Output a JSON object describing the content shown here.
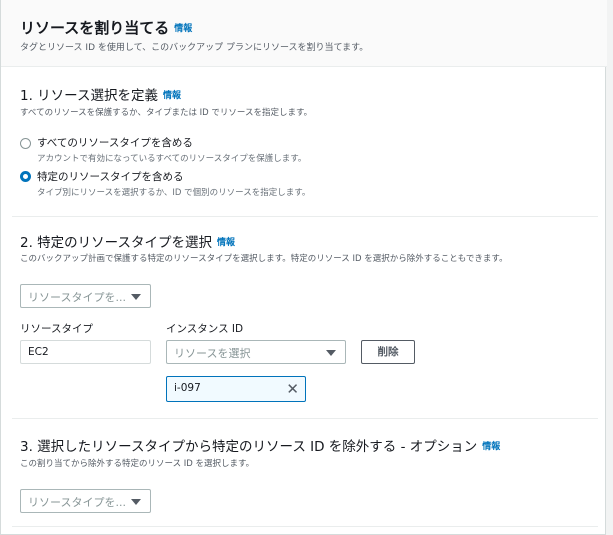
{
  "header": {
    "title": "リソースを割り当てる",
    "info": "情報",
    "description": "タグとリソース ID を使用して、このバックアップ プランにリソースを割り当てます。"
  },
  "section1": {
    "title": "1. リソース選択を定義",
    "info": "情報",
    "description": "すべてのリソースを保護するか、タイプまたは ID でリソースを指定します。",
    "options": [
      {
        "label": "すべてのリソースタイプを含める",
        "description": "アカウントで有効になっているすべてのリソースタイプを保護します。",
        "selected": false
      },
      {
        "label": "特定のリソースタイプを含める",
        "description": "タイプ別にリソースを選択するか、ID で個別のリソースを指定します。",
        "selected": true
      }
    ]
  },
  "section2": {
    "title": "2. 特定のリソースタイプを選択",
    "info": "情報",
    "description": "このバックアップ計画で保護する特定のリソースタイプを選択します。特定のリソース ID を選択から除外することもできます。",
    "type_select_placeholder": "リソースタイプを...",
    "resource_type_label": "リソースタイプ",
    "resource_type_value": "EC2",
    "instance_id_label": "インスタンス ID",
    "instance_select_placeholder": "リソースを選択",
    "delete_button": "削除",
    "token_value": "i-097"
  },
  "section3": {
    "title": "3. 選択したリソースタイプから特定のリソース ID を除外する - オプション",
    "info": "情報",
    "description": "この割り当てから除外する特定のリソース ID を選択します。",
    "type_select_placeholder": "リソースタイプを..."
  }
}
